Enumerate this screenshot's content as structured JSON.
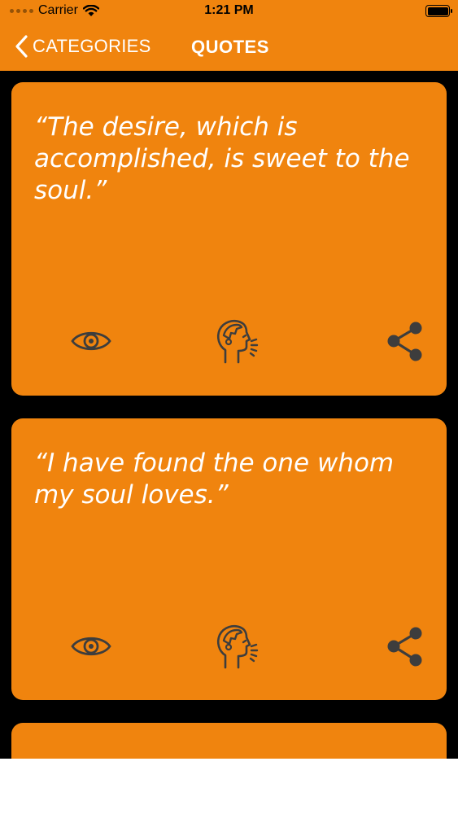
{
  "status_bar": {
    "carrier": "Carrier",
    "time": "1:21 PM"
  },
  "nav": {
    "back_label": "CATEGORIES",
    "title": "QUOTES"
  },
  "quotes": [
    {
      "text": "“The desire, which is accomplished, is sweet to the soul.”"
    },
    {
      "text": "“I have found the one whom my soul loves.”"
    }
  ],
  "icons": {
    "view": "eye-icon",
    "speak": "speaking-head-icon",
    "share": "share-icon"
  },
  "colors": {
    "accent": "#f0840e",
    "icon": "#3d3d3d",
    "background": "#000000",
    "text": "#ffffff"
  }
}
